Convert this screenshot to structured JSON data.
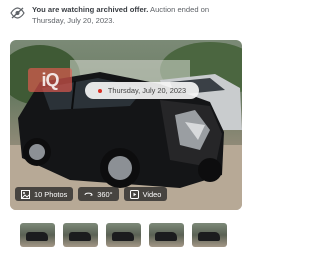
{
  "notice": {
    "strong_text": "You are watching archived offer.",
    "rest_text": " Auction ended on Thursday, July 20, 2023."
  },
  "gallery": {
    "watermark": "iQ",
    "date_label": "Thursday, July 20, 2023",
    "buttons": {
      "photos": "10 Photos",
      "spin": "360°",
      "video": "Video"
    }
  },
  "thumbnails": [
    "thumb-1",
    "thumb-2",
    "thumb-3",
    "thumb-4",
    "thumb-5"
  ]
}
